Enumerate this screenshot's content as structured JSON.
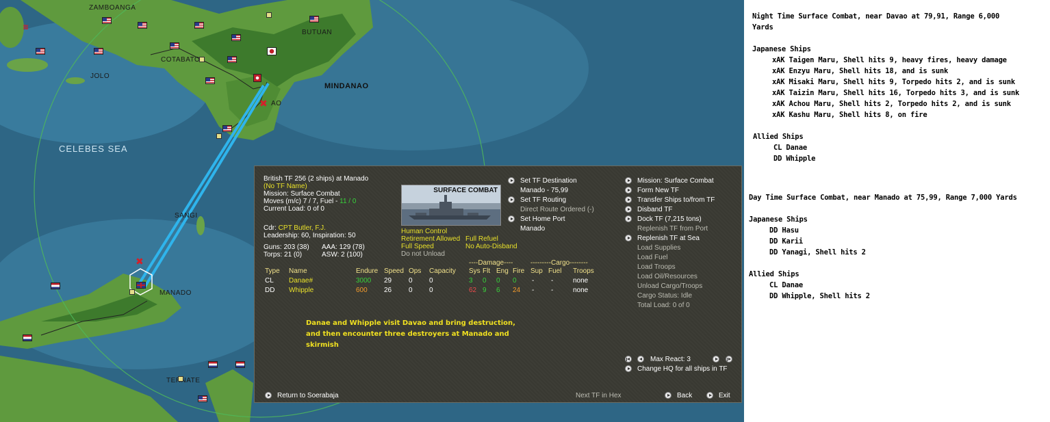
{
  "map": {
    "labels": {
      "zamboanga": "ZAMBOANGA",
      "cotabato": "COTABATO",
      "butuan": "BUTUAN",
      "jolo": "JOLO",
      "mindanao": "MINDANAO",
      "davao": "AO",
      "celebes_sea": "CELEBES SEA",
      "sangi": "SANGI",
      "manado": "MANADO",
      "ternate": "TERNATE"
    }
  },
  "panel": {
    "tf_title": "British TF 256 (2 ships) at Manado",
    "tf_name": "(No TF Name)",
    "mission": "Mission: Surface Combat",
    "moves_prefix": "Moves (m/c) 7 / 7, Fuel - ",
    "moves_fuel": "11 / 0",
    "current_load": "Current Load: 0 of 0",
    "cdr_prefix": "Cdr: ",
    "cdr_name": "CPT Butler, F.J.",
    "leadership": "Leadership: 60, Inspiration: 50",
    "guns": "Guns: 203 (38)",
    "aaa": "AAA: 129 (78)",
    "torps": "Torps: 21 (0)",
    "asw": "ASW: 2 (100)",
    "photo_caption": "SURFACE COMBAT",
    "human_control": "Human Control",
    "retirement": "Retirement Allowed",
    "full_refuel": "Full Refuel",
    "full_speed": "Full Speed",
    "no_auto_disband": "No Auto-Disband",
    "do_not_unload": "Do not Unload",
    "set_tf_destination": "Set TF Destination",
    "destination_value": "Manado - 75,99",
    "set_tf_routing": "Set TF Routing",
    "direct_route": "Direct Route Ordered (-)",
    "set_home_port": "Set Home Port",
    "home_port_value": "Manado",
    "right_menu": {
      "mission_surface": "Mission: Surface Combat",
      "form_new_tf": "Form New TF",
      "transfer_ships": "Transfer Ships to/from TF",
      "disband_tf": "Disband TF",
      "dock_tf": "Dock TF (7,215 tons)",
      "replenish_from_port": "Replenish TF from Port",
      "replenish_at_sea": "Replenish TF at Sea",
      "load_supplies": "Load Supplies",
      "load_fuel": "Load Fuel",
      "load_troops": "Load Troops",
      "load_oil": "Load Oil/Resources",
      "unload_cargo": "Unload Cargo/Troops",
      "cargo_status": "Cargo Status: Idle",
      "total_load": "Total Load: 0 of 0"
    },
    "damage_header": "----Damage----",
    "cargo_header": "---------Cargo--------",
    "columns": {
      "type": "Type",
      "name": "Name",
      "endure": "Endure",
      "speed": "Speed",
      "ops": "Ops",
      "capacity": "Capacity",
      "sys": "Sys",
      "flt": "Flt",
      "eng": "Eng",
      "fire": "Fire",
      "sup": "Sup",
      "fuel": "Fuel",
      "troops": "Troops"
    },
    "ships": [
      {
        "type": "CL",
        "name": "Danae#",
        "endure": "3000",
        "speed": "29",
        "ops": "0",
        "capacity": "0",
        "sys": "3",
        "flt": "0",
        "eng": "0",
        "fire": "0",
        "sup": "-",
        "fuel": "-",
        "troops": "none"
      },
      {
        "type": "DD",
        "name": "Whipple",
        "endure": "600",
        "speed": "26",
        "ops": "0",
        "capacity": "0",
        "sys": "62",
        "flt": "9",
        "eng": "6",
        "fire": "24",
        "sup": "-",
        "fuel": "-",
        "troops": "none"
      }
    ],
    "note": "Danae and Whipple visit Davao and bring destruction, and then encounter three destroyers at Manado and skirmish",
    "max_react": "Max React:  3",
    "change_hq": "Change HQ for all ships in TF",
    "return_to": "Return to Soerabaja",
    "next_tf": "Next TF in Hex",
    "back": "Back",
    "exit": "Exit"
  },
  "log": {
    "combat1_title": "Night Time Surface Combat, near Davao at 79,91, Range 6,000",
    "combat1_title2": "Yards",
    "japanese_ships_1": "Japanese Ships",
    "jp1": [
      "xAK Taigen Maru, Shell hits 9,  heavy fires,  heavy damage",
      "xAK Enzyu Maru, Shell hits 18, and is sunk",
      "xAK Misaki Maru, Shell hits 9, Torpedo hits 2, and is sunk",
      "xAK Taizin Maru, Shell hits 16, Torpedo hits 3, and is sunk",
      "xAK Achou Maru, Shell hits 2, Torpedo hits 2, and is sunk",
      "xAK Kashu Maru, Shell hits 8,  on fire"
    ],
    "allied_ships_1": "Allied Ships",
    "al1": [
      "CL Danae",
      "DD Whipple"
    ],
    "combat2_title": "Day Time Surface Combat, near Manado at 75,99, Range 7,000 Yards",
    "japanese_ships_2": "Japanese Ships",
    "jp2": [
      "DD Hasu",
      "DD Karii",
      "DD Yanagi, Shell hits 2"
    ],
    "allied_ships_2": "Allied Ships",
    "al2": [
      "CL Danae",
      "DD Whipple, Shell hits 2"
    ]
  }
}
